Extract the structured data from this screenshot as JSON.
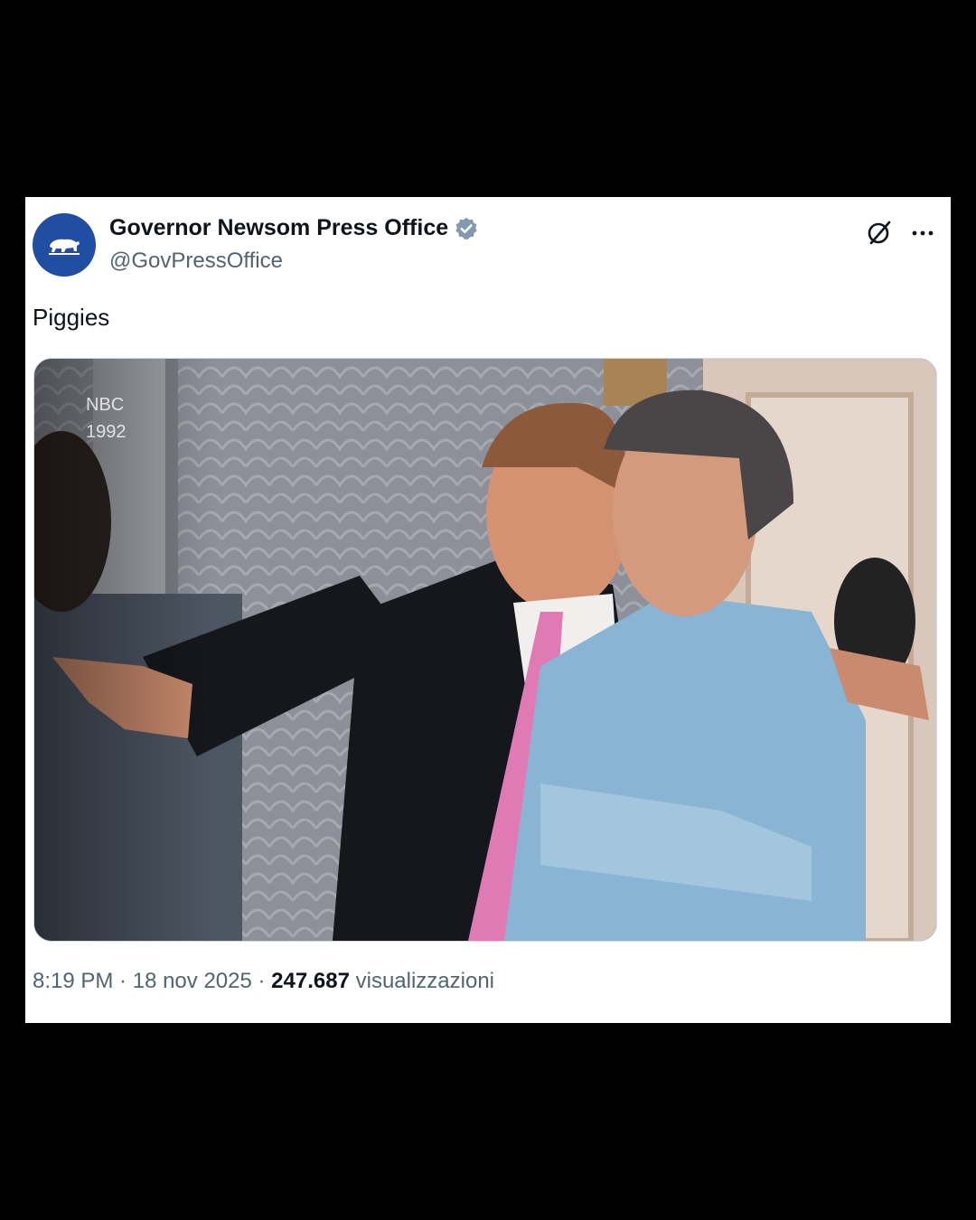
{
  "author": {
    "display_name": "Governor Newsom Press Office",
    "handle": "@GovPressOffice",
    "avatar_icon": "california-bear-icon",
    "verified_icon": "verified-badge-icon",
    "avatar_color": "#1f4ea3"
  },
  "header_actions": {
    "grok_icon": "grok-icon",
    "more_icon": "more-options-icon"
  },
  "tweet": {
    "text": "Piggies"
  },
  "media": {
    "watermark_network": "NBC",
    "watermark_year": "1992"
  },
  "meta": {
    "time": "8:19 PM",
    "separator1": " · ",
    "date": "18 nov 2025",
    "separator2": " · ",
    "views_count": "247.687",
    "views_label": "visualizzazioni"
  }
}
